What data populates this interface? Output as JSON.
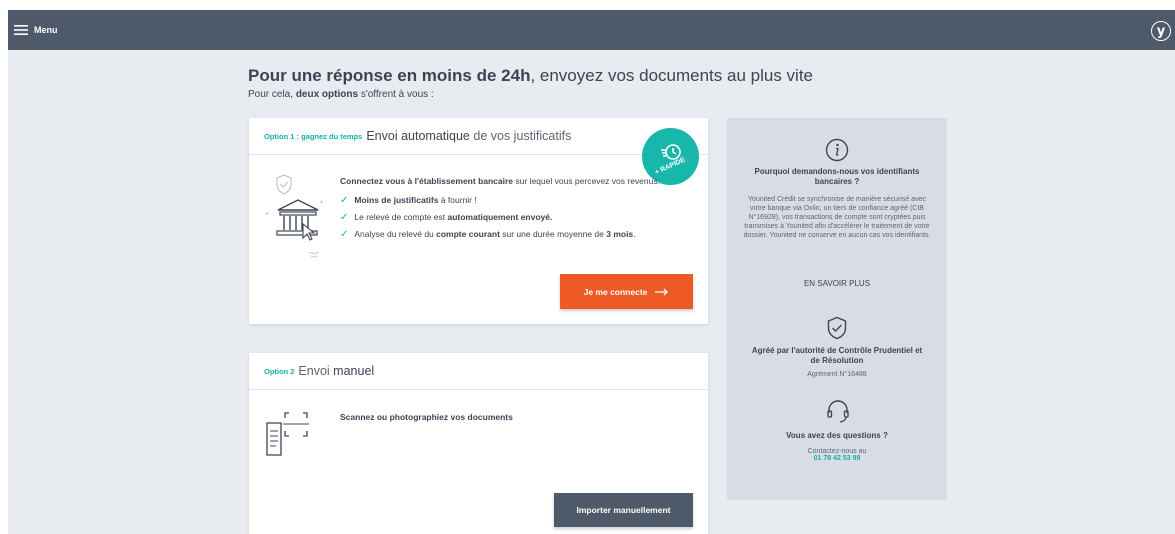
{
  "topbar": {
    "menu_label": "Menu",
    "logo_letter": "y"
  },
  "heading": {
    "bold": "Pour une réponse en moins de 24h",
    "rest": ", envoyez vos documents au plus vite"
  },
  "subheading": {
    "pre": "Pour cela, ",
    "bold": "deux options",
    "post": " s'offrent à vous :"
  },
  "option1": {
    "label": "Option 1 : gagnez du temps",
    "title_bold": "Envoi automatique",
    "title_rest": " de vos justificatifs",
    "badge": "+ RAPIDE",
    "intro_bold": "Connectez vous à l'établissement bancaire",
    "intro_rest": " sur lequel vous percevez vos revenus.",
    "check1_bold": "Moins de justificatifs",
    "check1_rest": " à fournir !",
    "check2_pre": "Le relevé de compte est ",
    "check2_bold": "automatiquement envoyé.",
    "check3_pre": "Analyse du relevé du ",
    "check3_bold": "compte courant",
    "check3_mid": " sur une durée moyenne de ",
    "check3_bold2": "3 mois",
    "check3_post": ".",
    "button": "Je me connecte"
  },
  "option2": {
    "label": "Option 2",
    "title_thin": "Envoi ",
    "title_bold": "manuel",
    "scan_text": "Scannez ou photographiez vos documents",
    "button": "Importer manuellement"
  },
  "sidebar": {
    "why_title": "Pourquoi demandons-nous vos identifiants bancaires ?",
    "why_text": "Younited Crédit se synchronise de manière sécurisé avec votre banque via Oxlin, un tiers de confiance agréé (CIB N°16928), vos transactions de compte sont cryptées puis transmises à Younited afin d'accélérer le traitement de votre dossier. Younited ne conserve en aucun cas vos identifiants.",
    "learn_more": "EN SAVOIR PLUS",
    "approved_title": "Agréé par l'autorité de Contrôle Prudentiel et de Résolution",
    "approved_text": "Agrément N°16488",
    "questions_title": "Vous avez des questions ?",
    "contact_text": "Contactez-nous au",
    "phone": "01 78 42 53 99"
  },
  "colors": {
    "accent": "#19b6ab",
    "orange": "#ee5a24",
    "dark": "#4e5969",
    "background": "#e8ebef"
  }
}
